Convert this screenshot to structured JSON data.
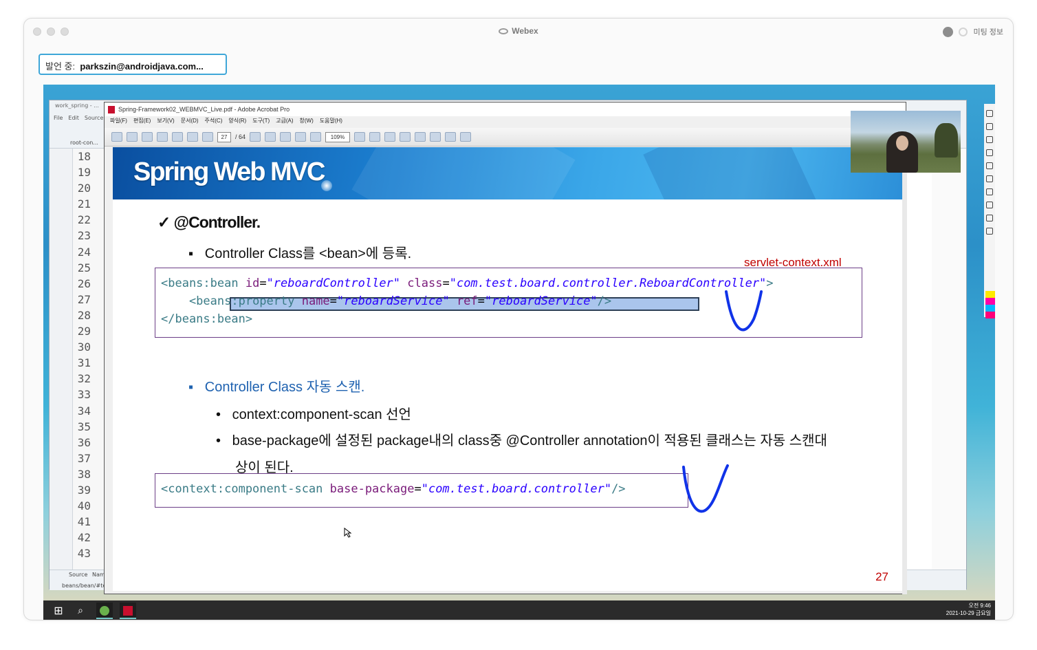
{
  "window": {
    "title": "Webex",
    "meeting_info": "미팅 정보"
  },
  "speaker": {
    "label": "발언 중:",
    "name": "parkszin@androidjava.com..."
  },
  "ide": {
    "title": "work_spring - ...",
    "menu": [
      "File",
      "Edit",
      "Source"
    ],
    "tab": "root-con...",
    "line_numbers": [
      "18",
      "19",
      "20",
      "21",
      "22",
      "23",
      "24",
      "25",
      "26",
      "27",
      "28",
      "29",
      "30",
      "31",
      "32",
      "33",
      "34",
      "35",
      "36",
      "37",
      "38",
      "39",
      "40",
      "41",
      "42",
      "43"
    ],
    "bottom_tabs": [
      "Source",
      "Nam..."
    ],
    "status": "beans/bean/#te..."
  },
  "acrobat": {
    "title": "Spring-Framework02_WEBMVC_Live.pdf - Adobe Acrobat Pro",
    "menu": [
      "파일(F)",
      "편집(E)",
      "보기(V)",
      "문서(D)",
      "주석(C)",
      "양식(R)",
      "도구(T)",
      "고급(A)",
      "창(W)",
      "도움말(H)"
    ],
    "page_current": "27",
    "page_total": "/ 64",
    "zoom": "109%"
  },
  "slide": {
    "title": "Spring Web MVC",
    "heading": "✓ @Controller.",
    "bullet1": "Controller Class를 <bean>에 등록.",
    "file_label": "servlet-context.xml",
    "code1": {
      "line1": {
        "open": "<beans:bean ",
        "a1": "id",
        "eq1": "=",
        "v1": "\"reboardController\"",
        "sp": " ",
        "a2": "class",
        "eq2": "=",
        "v2": "\"com.test.board.controller.ReboardController\"",
        "close": ">"
      },
      "line2": {
        "indent": "    <bean",
        "rest": "s:property ",
        "a1": "name",
        "eq1": "=",
        "v1": "\"reboardService\"",
        "sp": " ",
        "a2": "ref",
        "eq2": "=",
        "v2": "\"reboardService\"",
        "close": "/>"
      },
      "line3": "</beans:bean>"
    },
    "bullet2": "Controller Class 자동 스캔.",
    "sub1": "context:component-scan 선언",
    "sub2_line1": "base-package에 설정된 package내의 class중 @Controller annotation이 적용된 클래스는 자동 스캔대",
    "sub2_line2": "상이 된다.",
    "code2": {
      "open": "<context:component-scan ",
      "a1": "base-package",
      "eq1": "=",
      "v1": "\"com.test.board.controller\"",
      "close": "/>"
    },
    "page_number": "27"
  },
  "taskbar": {
    "time": "오전 9:46",
    "date": "2021-10-29 금요일"
  },
  "colors": {
    "accent": "#3ea6d8",
    "code_border": "#6b3d86",
    "annotation": "#1033e8",
    "page_number": "#c00000"
  }
}
